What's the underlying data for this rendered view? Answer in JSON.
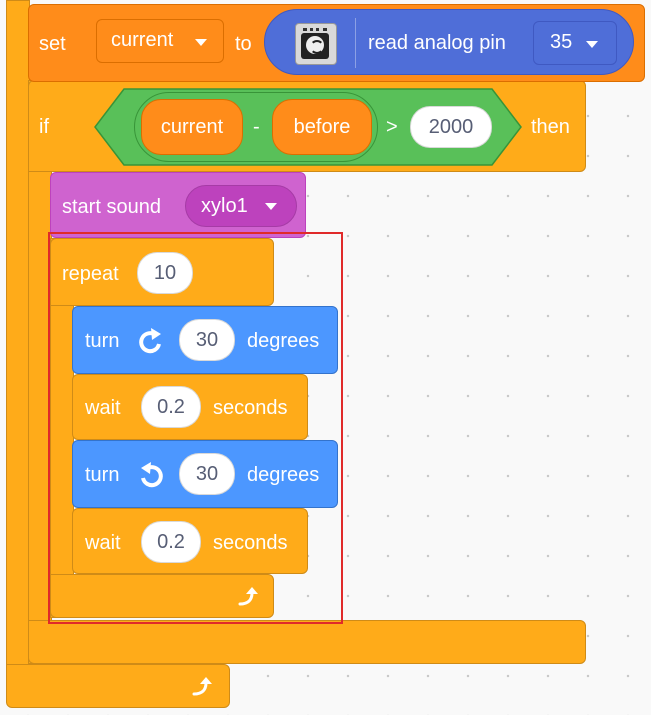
{
  "set_block": {
    "label": "set",
    "variable": "current",
    "to_label": "to",
    "reporter_label": "read analog pin",
    "pin": "35"
  },
  "if_block": {
    "label": "if",
    "left_var": "current",
    "minus": "-",
    "right_var": "before",
    "gt": ">",
    "threshold": "2000",
    "then_label": "then"
  },
  "sound_block": {
    "label": "start sound",
    "sound": "xylo1"
  },
  "repeat_block": {
    "label": "repeat",
    "times": "10"
  },
  "turn_right": {
    "label": "turn",
    "degrees": "30",
    "unit": "degrees"
  },
  "wait_1": {
    "label": "wait",
    "seconds": "0.2",
    "unit": "seconds"
  },
  "turn_left": {
    "label": "turn",
    "degrees": "30",
    "unit": "degrees"
  },
  "wait_2": {
    "label": "wait",
    "seconds": "0.2",
    "unit": "seconds"
  },
  "icons": [
    "esp32-chip-icon",
    "rotate-right-icon",
    "rotate-left-icon",
    "repeat-arrow-icon"
  ],
  "colors": {
    "control": "#ffab19",
    "variable": "#ff8c1a",
    "motion": "#4c97ff",
    "sound": "#cf63cf",
    "operator": "#59c059",
    "extension": "#4f6ed8",
    "selection": "#e02a2a"
  }
}
